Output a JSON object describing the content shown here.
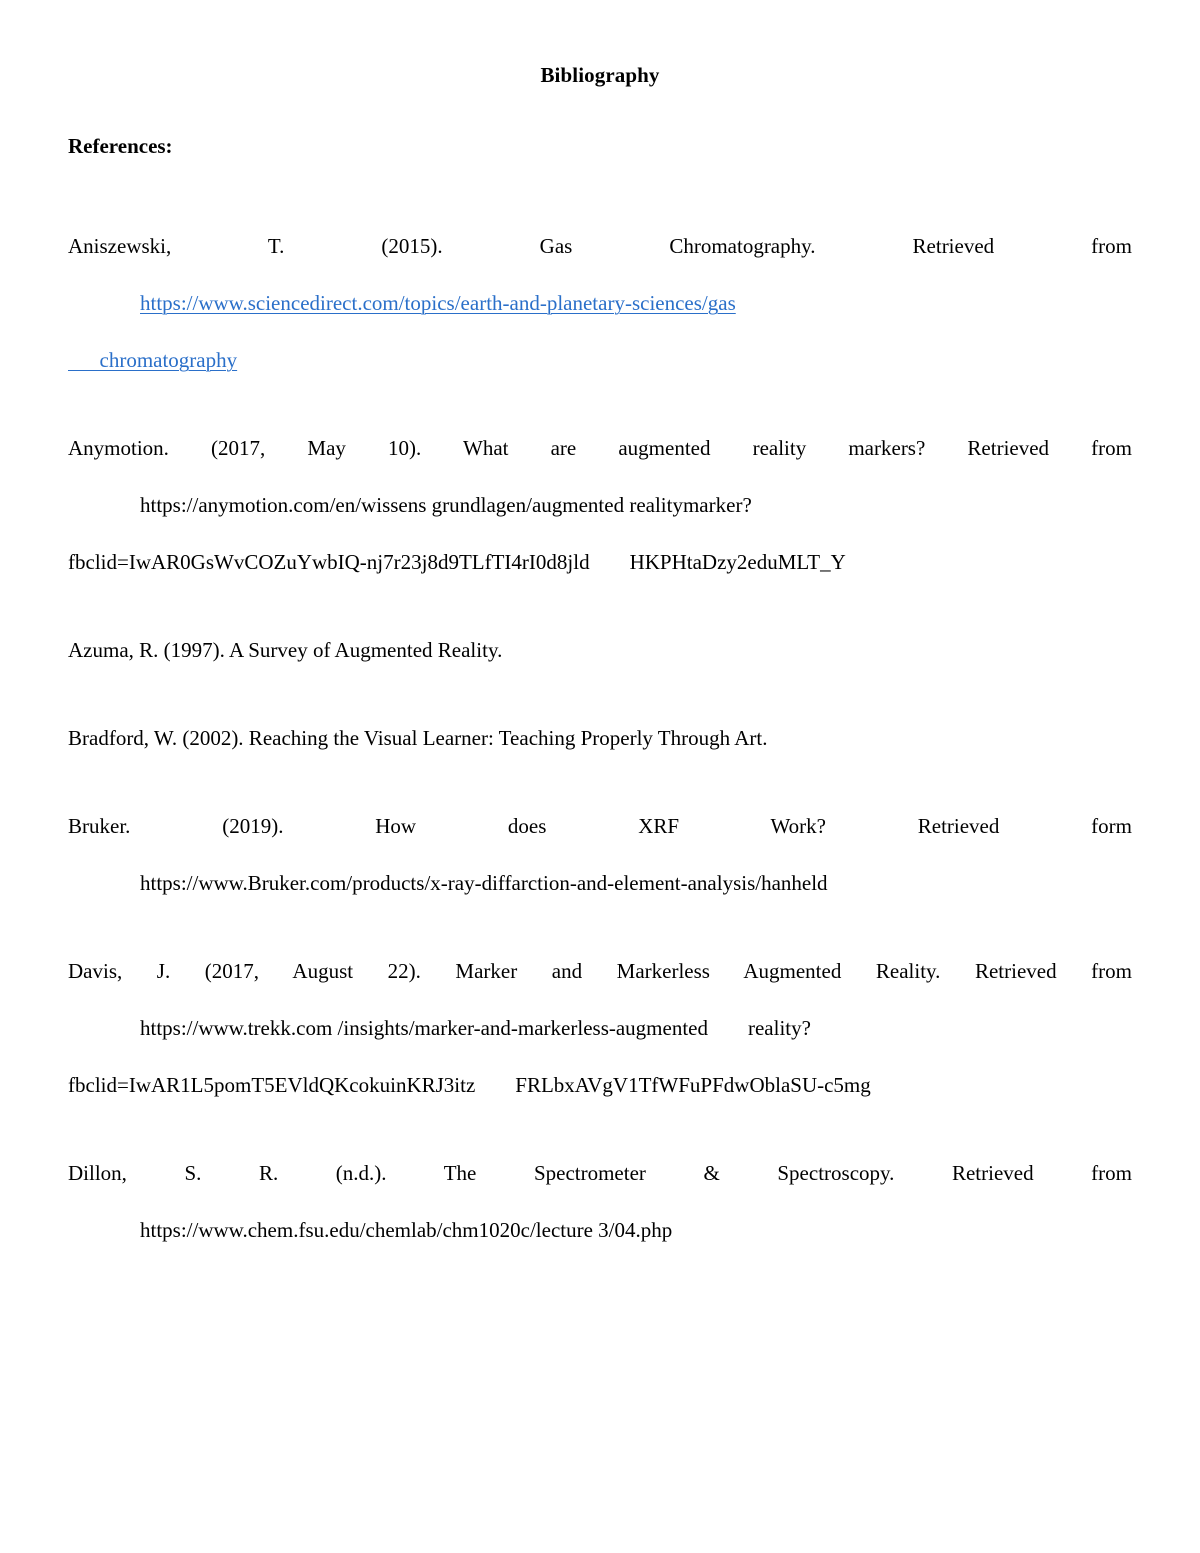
{
  "document": {
    "title": "Bibliography",
    "section_heading": "References:",
    "link_color": "#2a6fc9",
    "text_color": "#000000",
    "page_background": "#ffffff"
  },
  "references": [
    {
      "id": "aniszewski-2015",
      "lines": [
        {
          "kind": "justified",
          "text": "Aniszewski, T. (2015). Gas Chromatography. Retrieved from"
        },
        {
          "kind": "link-indent",
          "text": "https://www.sciencedirect.com/topics/earth-and-planetary-sciences/gas"
        },
        {
          "kind": "link-lead-indent",
          "lead": "      ",
          "text": "chromatography"
        }
      ]
    },
    {
      "id": "anymotion-2017",
      "lines": [
        {
          "kind": "justified",
          "text": "Anymotion. (2017, May 10). What are augmented reality markers? Retrieved from"
        },
        {
          "kind": "indent-flush",
          "text": "https://anymotion.com/en/wissens grundlagen/augmented realitymarker?"
        },
        {
          "kind": "flush-split",
          "left": "fbclid=IwAR0GsWvCOZuYwbIQ-nj7r23j8d9TLfTI4rI0d8jld",
          "right": "HKPHtaDzy2eduMLT_Y"
        }
      ]
    },
    {
      "id": "azuma-1997",
      "lines": [
        {
          "kind": "flush",
          "text": "Azuma, R. (1997). A Survey of Augmented Reality."
        }
      ]
    },
    {
      "id": "bradford-2002",
      "lines": [
        {
          "kind": "flush",
          "text": "Bradford, W. (2002). Reaching the Visual Learner: Teaching Properly Through Art."
        }
      ]
    },
    {
      "id": "bruker-2019",
      "lines": [
        {
          "kind": "justified",
          "text": "Bruker. (2019). How does XRF Work? Retrieved form"
        },
        {
          "kind": "indent-flush",
          "text": "https://www.Bruker.com/products/x-ray-diffarction-and-element-analysis/hanheld"
        }
      ]
    },
    {
      "id": "davis-2017",
      "lines": [
        {
          "kind": "justified",
          "text": "Davis, J. (2017, August 22). Marker and Markerless Augmented Reality. Retrieved from"
        },
        {
          "kind": "indent-split",
          "left": "https://www.trekk.com /insights/marker-and-markerless-augmented",
          "right": "reality?"
        },
        {
          "kind": "flush-split",
          "left": "fbclid=IwAR1L5pomT5EVldQKcokuinKRJ3itz",
          "right": "FRLbxAVgV1TfWFuPFdwOblaSU-c5mg"
        }
      ]
    },
    {
      "id": "dillon-nd",
      "lines": [
        {
          "kind": "justified",
          "text": "Dillon, S. R. (n.d.). The Spectrometer & Spectroscopy. Retrieved from"
        },
        {
          "kind": "indent-flush",
          "text": "https://www.chem.fsu.edu/chemlab/chm1020c/lecture 3/04.php"
        }
      ]
    }
  ]
}
